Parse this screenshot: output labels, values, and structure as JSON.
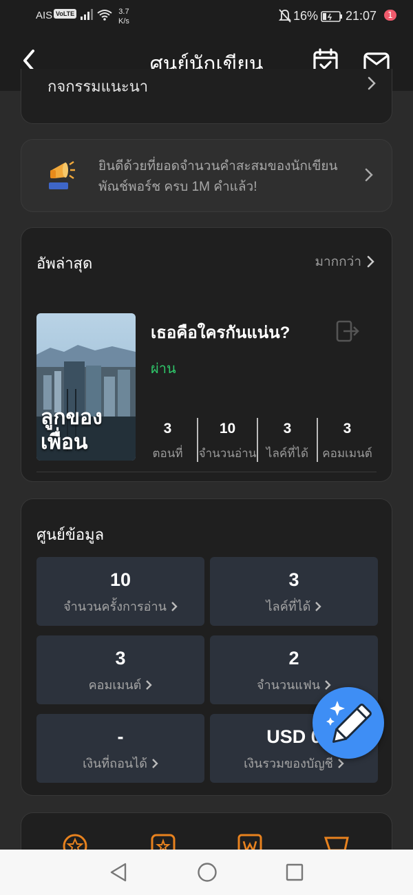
{
  "status_bar": {
    "carrier": "AIS",
    "volte": "VoLTE",
    "speed_value": "3.7",
    "speed_unit": "K/s",
    "battery_percent": "16%",
    "time": "21:07"
  },
  "header": {
    "title": "ศูนย์นักเขียน",
    "mail_badge": "1"
  },
  "activity": {
    "label": "กิจกรรมแนะนำ"
  },
  "announcement": {
    "text": "ยินดีด้วยที่ยอดจำนวนคำสะสมของนักเขียน พัณช์พอร์ช ครบ 1M คำแล้ว!"
  },
  "updates": {
    "title": "อัพล่าสุด",
    "more": "มากกว่า",
    "book": {
      "cover_title": "ลูกของเพื่อน",
      "title": "เธอคือใครกันแน่น?",
      "status": "ผ่าน",
      "stats": [
        {
          "value": "3",
          "label": "ตอนที่"
        },
        {
          "value": "10",
          "label": "จำนวนอ่าน"
        },
        {
          "value": "3",
          "label": "ไลค์ที่ได้"
        },
        {
          "value": "3",
          "label": "คอมเมนต์"
        }
      ]
    }
  },
  "datacenter": {
    "title": "ศูนย์ข้อมูล",
    "tiles": [
      {
        "value": "10",
        "label": "จำนวนครั้งการอ่าน"
      },
      {
        "value": "3",
        "label": "ไลค์ที่ได้"
      },
      {
        "value": "3",
        "label": "คอมเมนต์"
      },
      {
        "value": "2",
        "label": "จำนวนแฟน"
      },
      {
        "value": "-",
        "label": "เงินที่ถอนได้"
      },
      {
        "value": "USD 0",
        "label": "เงินรวมของบัญชี"
      }
    ]
  },
  "colors": {
    "accent_blue": "#3e8ef5",
    "status_green": "#2fc96b",
    "badge_red": "#f05a6c",
    "tool_orange": "#e8821e"
  }
}
